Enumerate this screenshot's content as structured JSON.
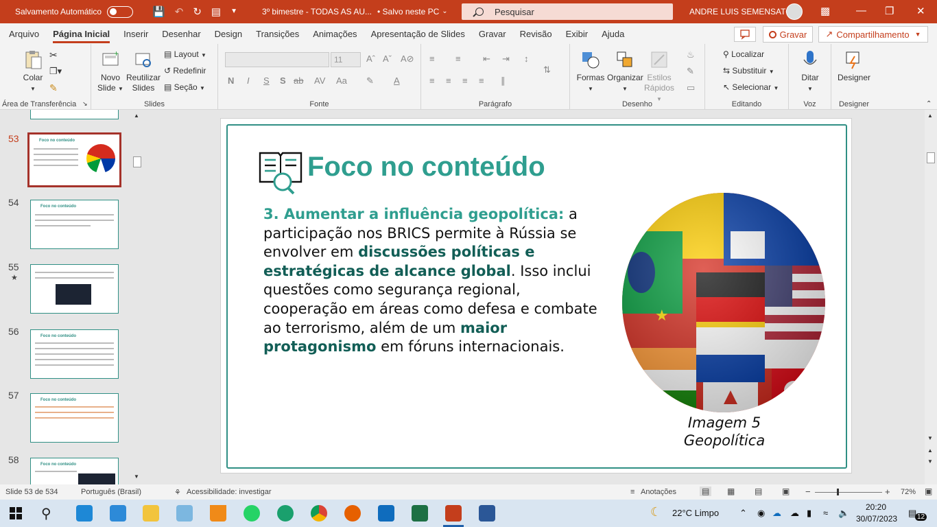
{
  "titlebar": {
    "autosave_label": "Salvamento Automático",
    "document_name": "3º bimestre - TODAS AS AU...",
    "save_status": "• Salvo neste PC",
    "search_placeholder": "Pesquisar",
    "user_name": "ANDRE LUIS SEMENSATO",
    "accent_color": "#c43e1c"
  },
  "menu": {
    "tabs": [
      "Arquivo",
      "Página Inicial",
      "Inserir",
      "Desenhar",
      "Design",
      "Transições",
      "Animações",
      "Apresentação de Slides",
      "Gravar",
      "Revisão",
      "Exibir",
      "Ajuda"
    ],
    "active_tab": "Página Inicial",
    "gravar_button": "Gravar",
    "share_button": "Compartilhamento"
  },
  "ribbon": {
    "clipboard": {
      "paste": "Colar",
      "group_label": "Área de Transferência"
    },
    "slides": {
      "new_slide_line1": "Novo",
      "new_slide_line2": "Slide",
      "reuse_line1": "Reutilizar",
      "reuse_line2": "Slides",
      "layout": "Layout",
      "reset": "Redefinir",
      "section": "Seção",
      "group_label": "Slides"
    },
    "font": {
      "size": "11",
      "bold": "N",
      "italic": "I",
      "underline": "S",
      "shadow": "S",
      "strike": "ab",
      "group_label": "Fonte"
    },
    "paragraph": {
      "group_label": "Parágrafo"
    },
    "drawing": {
      "shapes": "Formas",
      "arrange": "Organizar",
      "styles_line1": "Estilos",
      "styles_line2": "Rápidos",
      "group_label": "Desenho"
    },
    "editing": {
      "find": "Localizar",
      "replace": "Substituir",
      "select": "Selecionar",
      "group_label": "Editando"
    },
    "voice": {
      "dictate": "Ditar",
      "group_label": "Voz"
    },
    "designer": {
      "designer": "Designer",
      "group_label": "Designer"
    }
  },
  "thumbnails": [
    {
      "number": "53",
      "title": "Foco no conteúdo",
      "active": true
    },
    {
      "number": "54",
      "title": "Foco no conteúdo",
      "active": false
    },
    {
      "number": "55",
      "title": "",
      "active": false,
      "star": "★"
    },
    {
      "number": "56",
      "title": "Foco no conteúdo",
      "active": false
    },
    {
      "number": "57",
      "title": "Foco no conteúdo",
      "active": false
    },
    {
      "number": "58",
      "title": "Foco no conteúdo",
      "active": false
    }
  ],
  "slide": {
    "title": "Foco no conteúdo",
    "heading": "3. Aumentar a influência geopolítica:",
    "text_1": " a participação nos BRICS permite à Rússia se envolver em ",
    "emphasis_1": "discussões políticas e estratégicas de alcance global",
    "text_2": ". Isso inclui questões como segurança regional, cooperação em áreas como defesa e combate ao terrorismo, além de um ",
    "emphasis_2": "maior protagonismo",
    "text_3": " em fóruns internacionais.",
    "caption_line1": "Imagem 5",
    "caption_line2": "Geopolítica",
    "theme_color": "#2f9e8f"
  },
  "statusbar": {
    "slide_info": "Slide 53 de 534",
    "language": "Português (Brasil)",
    "accessibility": "Acessibilidade: investigar",
    "notes": "Anotações",
    "zoom": "72%"
  },
  "taskbar": {
    "weather": "22°C  Limpo",
    "time": "20:20",
    "date": "30/07/2023",
    "notifications": "12"
  }
}
